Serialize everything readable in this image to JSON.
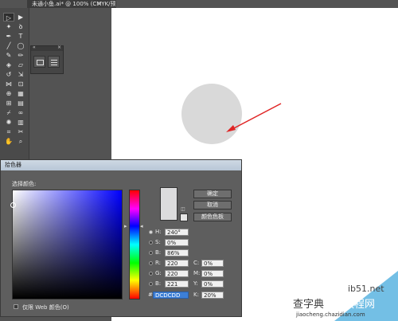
{
  "document_tab": {
    "title": "未通小鱼.ai* @ 100% (CMYK/预览)",
    "close": "×"
  },
  "panel_header": {
    "collapse": "«",
    "close": "×"
  },
  "color_picker": {
    "title": "拾色器",
    "select_color_label": "选择颜色:",
    "buttons": {
      "ok": "确定",
      "cancel": "取消",
      "swatches": "颜色色板"
    },
    "fields": [
      {
        "label": "H:",
        "value": "240°",
        "checked": true
      },
      {
        "label": "S:",
        "value": "0%"
      },
      {
        "label": "B:",
        "value": "86%"
      },
      {
        "label": "R:",
        "value": "220"
      },
      {
        "label": "G:",
        "value": "220"
      },
      {
        "label": "B:",
        "value": "221"
      }
    ],
    "cmyk": [
      {
        "label": "C:",
        "value": "0%"
      },
      {
        "label": "M:",
        "value": "0%"
      },
      {
        "label": "Y:",
        "value": "0%"
      },
      {
        "label": "K:",
        "value": "20%"
      }
    ],
    "hex_label": "#",
    "hex_value": "DCDCDD",
    "web_only_label": "仅限 Web 颜色(O)",
    "current_color": "#dcdcdd"
  },
  "watermark": {
    "site": "ib51.net",
    "text1": "查字典",
    "text2": "教程网",
    "url": "jiaocheng.chazidian.com"
  },
  "colors": {
    "circle": "#d9d9d9",
    "arrow": "#e02424"
  }
}
